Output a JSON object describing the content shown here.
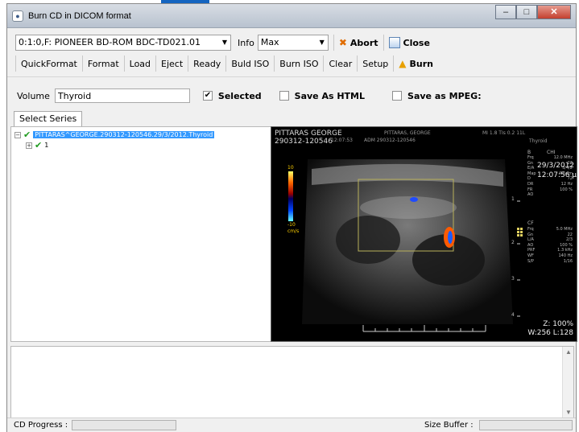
{
  "window": {
    "title": "Burn CD in DICOM format",
    "controls": {
      "minimize": "–",
      "maximize": "□",
      "close": "✕"
    }
  },
  "toolbar1": {
    "device_value": "0:1:0,F: PIONEER BD-ROM  BDC-TD021.01",
    "info_label": "Info",
    "info_value": "Max",
    "abort_label": "Abort",
    "close_label": "Close"
  },
  "toolbar2": {
    "buttons": [
      "QuickFormat",
      "Format",
      "Load",
      "Eject",
      "Ready",
      "Buld ISO",
      "Burn ISO",
      "Clear",
      "Setup"
    ],
    "burn_label": "Burn"
  },
  "options": {
    "volume_label": "Volume",
    "volume_value": "Thyroid",
    "selected_label": "Selected",
    "selected_checked": true,
    "save_html_label": "Save As HTML",
    "save_html_checked": false,
    "save_mpeg_label": "Save as MPEG:",
    "save_mpeg_checked": false
  },
  "tabs": {
    "select_series": "Select Series"
  },
  "tree": {
    "root_label": "PITTARAS^GEORGE.290312-120546.29/3/2012.Thyroid",
    "child_label": "1"
  },
  "image": {
    "header_left_line1": "PITTARAS GEORGE",
    "header_left_line2": "290312-120546",
    "header_time": "12:07:53",
    "header_adm": "ADM  290312-120546",
    "header_name_ghost": "PITTARAS, GEORGE",
    "header_mi": "MI 1.8  TIs 0.2  11L",
    "header_protocol": "Thyroid",
    "overlay_b": "B",
    "overlay_b_val": "CHI",
    "overlay_date": "29/3/2012",
    "overlay_time": "12:07:56 µ",
    "params_left": [
      "Frq",
      "Gn",
      "E/A",
      "Map",
      "D",
      "DR",
      "FR",
      "AO"
    ],
    "params_right": [
      "12.0 MHz",
      "22",
      "3/4/2",
      "",
      "4.0 cm",
      "72",
      "12 Hz",
      "100 %"
    ],
    "cf_label": "CF",
    "cf_params_left": [
      "Frq",
      "Gn",
      "L/A",
      "AO",
      "PRF",
      "WF",
      "S/P"
    ],
    "cf_params_right": [
      "5.0 MHz",
      "22",
      "2/3",
      "100 %",
      "1.3 kHz",
      "140 Hz",
      "1/16"
    ],
    "scale_top": "10",
    "scale_bottom": "-10",
    "scale_unit": "cm/s",
    "zoom": "Z: 100%",
    "window_level": "W:256 L:128",
    "depth_marks": [
      "1",
      "2",
      "3",
      "4"
    ],
    "colors": {
      "text": "#dcdcdc",
      "roi": "#b8b05a",
      "bg": "#000000"
    }
  },
  "status": {
    "cd_progress_label": "CD Progress :",
    "cd_progress_fraction": 0,
    "size_buffer_label": "Size Buffer :",
    "size_buffer_fraction": 0
  },
  "icons": {
    "app": "disc-icon",
    "abort": "abort-x-icon",
    "close": "close-window-icon",
    "burn": "flame-icon",
    "check": "✔",
    "expand": "−",
    "expand_child": "+"
  }
}
